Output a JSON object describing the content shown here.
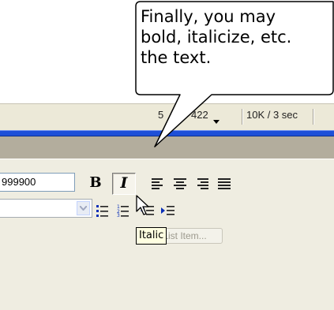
{
  "callout": {
    "lines": [
      "Finally, you may",
      "bold, italicize, etc.",
      "the text."
    ]
  },
  "status_bar": {
    "window_size": "5",
    "window_size_rest": "422",
    "download_stats": "10K / 3 sec"
  },
  "properties": {
    "size_value": "999900",
    "bold_label": "B",
    "italic_label": "I",
    "list_item_label": "List Item..."
  },
  "tooltip": {
    "text": "Italic"
  },
  "colors": {
    "accent_blue": "#1d4fd8",
    "panel_bg": "#efede1",
    "header_bg": "#b3ad9d",
    "tooltip_bg": "#ffffe1"
  }
}
